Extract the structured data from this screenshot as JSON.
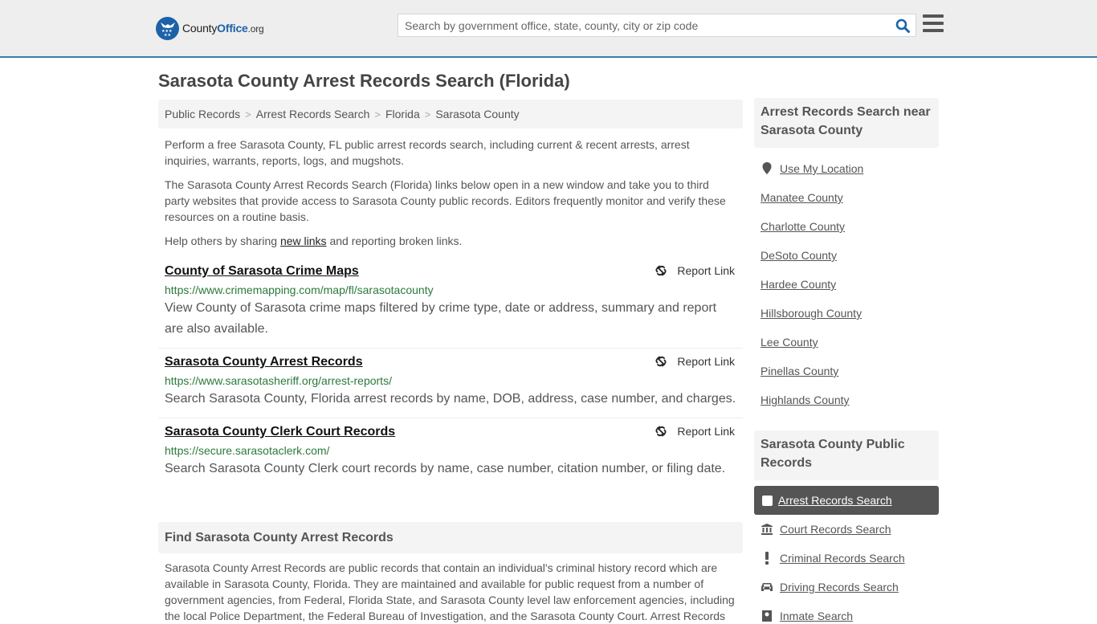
{
  "header": {
    "logo": {
      "county": "County",
      "office": "Office",
      "org": ".org"
    },
    "search_placeholder": "Search by government office, state, county, city or zip code",
    "search_icon": "search-icon",
    "menu_icon": "hamburger-menu-icon",
    "accent_color": "#1d62a8"
  },
  "page": {
    "title": "Sarasota County Arrest Records Search (Florida)"
  },
  "breadcrumb": [
    "Public Records",
    "Arrest Records Search",
    "Florida",
    "Sarasota County"
  ],
  "intro": {
    "p1": "Perform a free Sarasota County, FL public arrest records search, including current & recent arrests, arrest inquiries, warrants, reports, logs, and mugshots.",
    "p2": "The Sarasota County Arrest Records Search (Florida) links below open in a new window and take you to third party websites that provide access to Sarasota County public records. Editors frequently monitor and verify these resources on a routine basis.",
    "p3_before": "Help others by sharing ",
    "p3_link": "new links",
    "p3_after": " and reporting broken links."
  },
  "listings": [
    {
      "title": "County of Sarasota Crime Maps",
      "url": "https://www.crimemapping.com/map/fl/sarasotacounty",
      "description": "View County of Sarasota crime maps filtered by crime type, date or address, summary and report are also available.",
      "report_label": "Report Link"
    },
    {
      "title": "Sarasota County Arrest Records",
      "url": "https://www.sarasotasheriff.org/arrest-reports/",
      "description": "Search Sarasota County, Florida arrest records by name, DOB, address, case number, and charges.",
      "report_label": "Report Link"
    },
    {
      "title": "Sarasota County Clerk Court Records",
      "url": "https://secure.sarasotaclerk.com/",
      "description": "Search Sarasota County Clerk court records by name, case number, citation number, or filing date.",
      "report_label": "Report Link"
    }
  ],
  "find_section": {
    "heading": "Find Sarasota County Arrest Records",
    "body": "Sarasota County Arrest Records are public records that contain an individual's criminal history record which are available in Sarasota County, Florida. They are maintained and available for public request from a number of government agencies, from Federal, Florida State, and Sarasota County level law enforcement agencies, including the local Police Department, the Federal Bureau of Investigation, and the Sarasota County Court. Arrest Records"
  },
  "sidebar": {
    "nearby_heading": "Arrest Records Search near Sarasota County",
    "use_location": "Use My Location",
    "nearby": [
      "Manatee County",
      "Charlotte County",
      "DeSoto County",
      "Hardee County",
      "Hillsborough County",
      "Lee County",
      "Pinellas County",
      "Highlands County"
    ],
    "public_records_heading": "Sarasota County Public Records",
    "public_records": [
      {
        "label": "Arrest Records Search",
        "icon": "square-icon",
        "active": true
      },
      {
        "label": "Court Records Search",
        "icon": "courthouse-icon",
        "active": false
      },
      {
        "label": "Criminal Records Search",
        "icon": "exclamation-icon",
        "active": false
      },
      {
        "label": "Driving Records Search",
        "icon": "car-icon",
        "active": false
      },
      {
        "label": "Inmate Search",
        "icon": "inmate-icon",
        "active": false
      }
    ]
  }
}
